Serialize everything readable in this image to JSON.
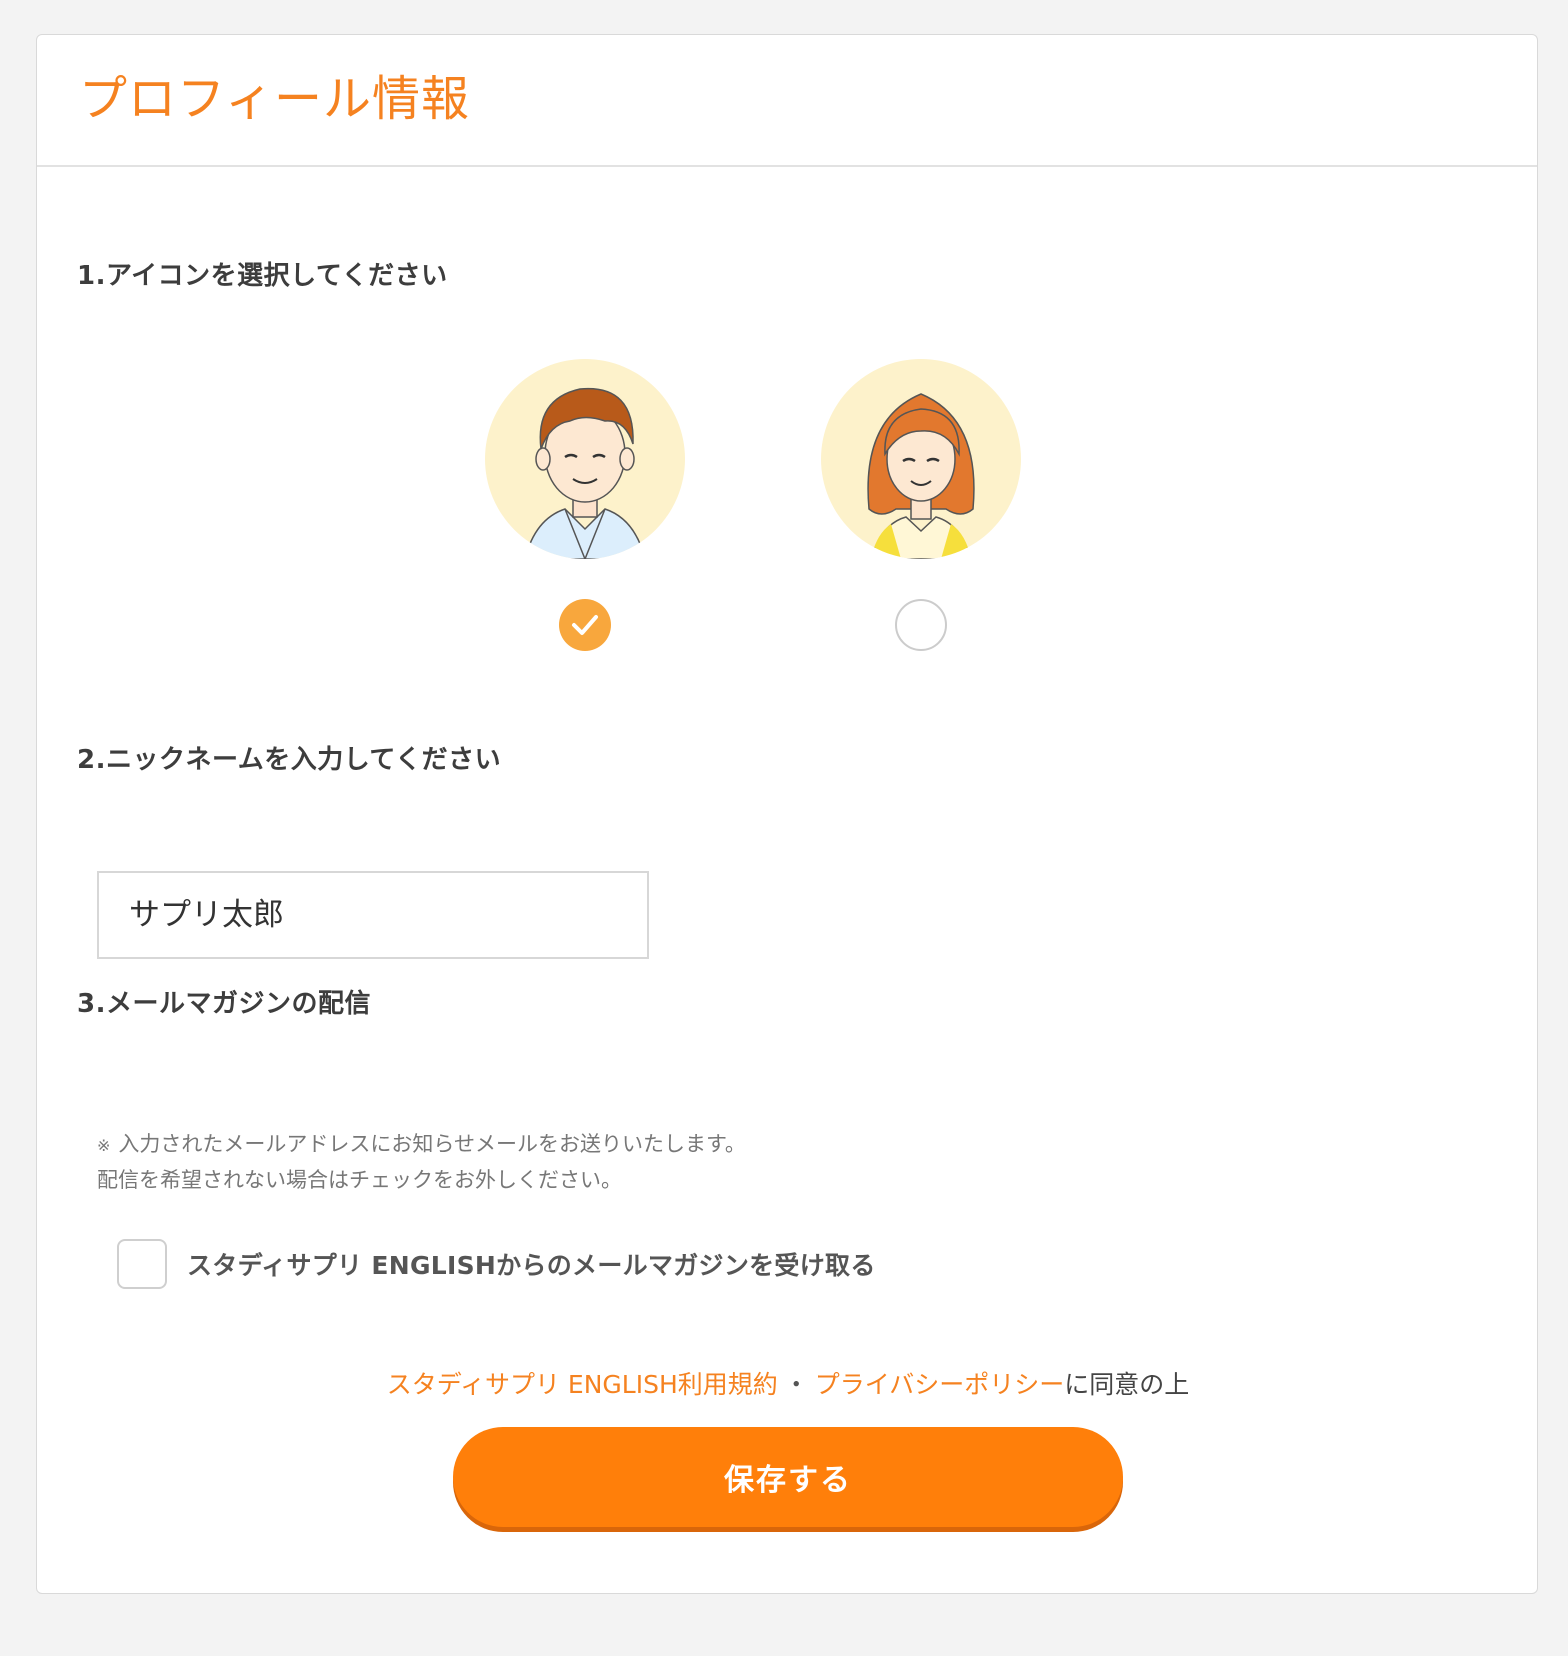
{
  "header": {
    "title": "プロフィール情報"
  },
  "section1": {
    "heading": "1.アイコンを選択してください",
    "options": [
      {
        "name": "male",
        "selected": true
      },
      {
        "name": "female",
        "selected": false
      }
    ]
  },
  "section2": {
    "heading": "2.ニックネームを入力してください",
    "nickname_value": "サプリ太郎"
  },
  "section3": {
    "heading": "3.メールマガジンの配信",
    "note_mark": "※",
    "note_line1": "入力されたメールアドレスにお知らせメールをお送りいたします。",
    "note_line2": "配信を希望されない場合はチェックをお外しください。",
    "checkbox_label": "スタディサプリ ENGLISHからのメールマガジンを受け取る",
    "checkbox_checked": false
  },
  "consent": {
    "terms_link": "スタディサプリ ENGLISH利用規約",
    "separator": "・",
    "privacy_link": "プライバシーポリシー",
    "suffix": "に同意の上"
  },
  "save_button": {
    "label": "保存する"
  },
  "colors": {
    "accent": "#f58220",
    "button": "#ff7f0a",
    "radio_checked": "#f8a73d",
    "avatar_bg": "#fdf2cb",
    "page_bg": "#f3f3f3"
  },
  "icons": {
    "check": "check-icon",
    "male_avatar": "male-avatar-icon",
    "female_avatar": "female-avatar-icon"
  }
}
